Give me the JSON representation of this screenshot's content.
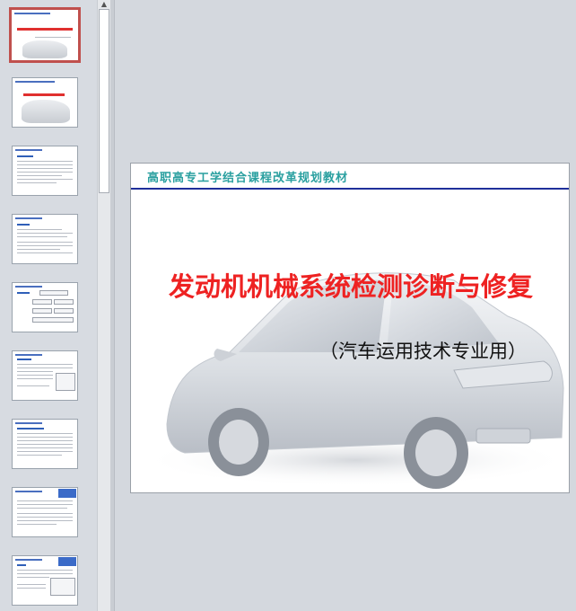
{
  "slide": {
    "header": "高职高专工学结合课程改革规划教材",
    "title": "发动机机械系统检测诊断与修复",
    "subtitle": "（汽车运用技术专业用）"
  },
  "thumbnails": [
    {
      "index": 1,
      "selected": true
    },
    {
      "index": 2,
      "selected": false
    },
    {
      "index": 3,
      "selected": false
    },
    {
      "index": 4,
      "selected": false
    },
    {
      "index": 5,
      "selected": false
    },
    {
      "index": 6,
      "selected": false
    },
    {
      "index": 7,
      "selected": false
    },
    {
      "index": 8,
      "selected": false
    },
    {
      "index": 9,
      "selected": false
    }
  ],
  "colors": {
    "title_red": "#ee2222",
    "header_teal": "#2aa0a0",
    "rule_navy": "#1f2f9a",
    "selection_border": "#c0504d"
  },
  "icons": {
    "scroll_up": "triangle-up-icon"
  }
}
